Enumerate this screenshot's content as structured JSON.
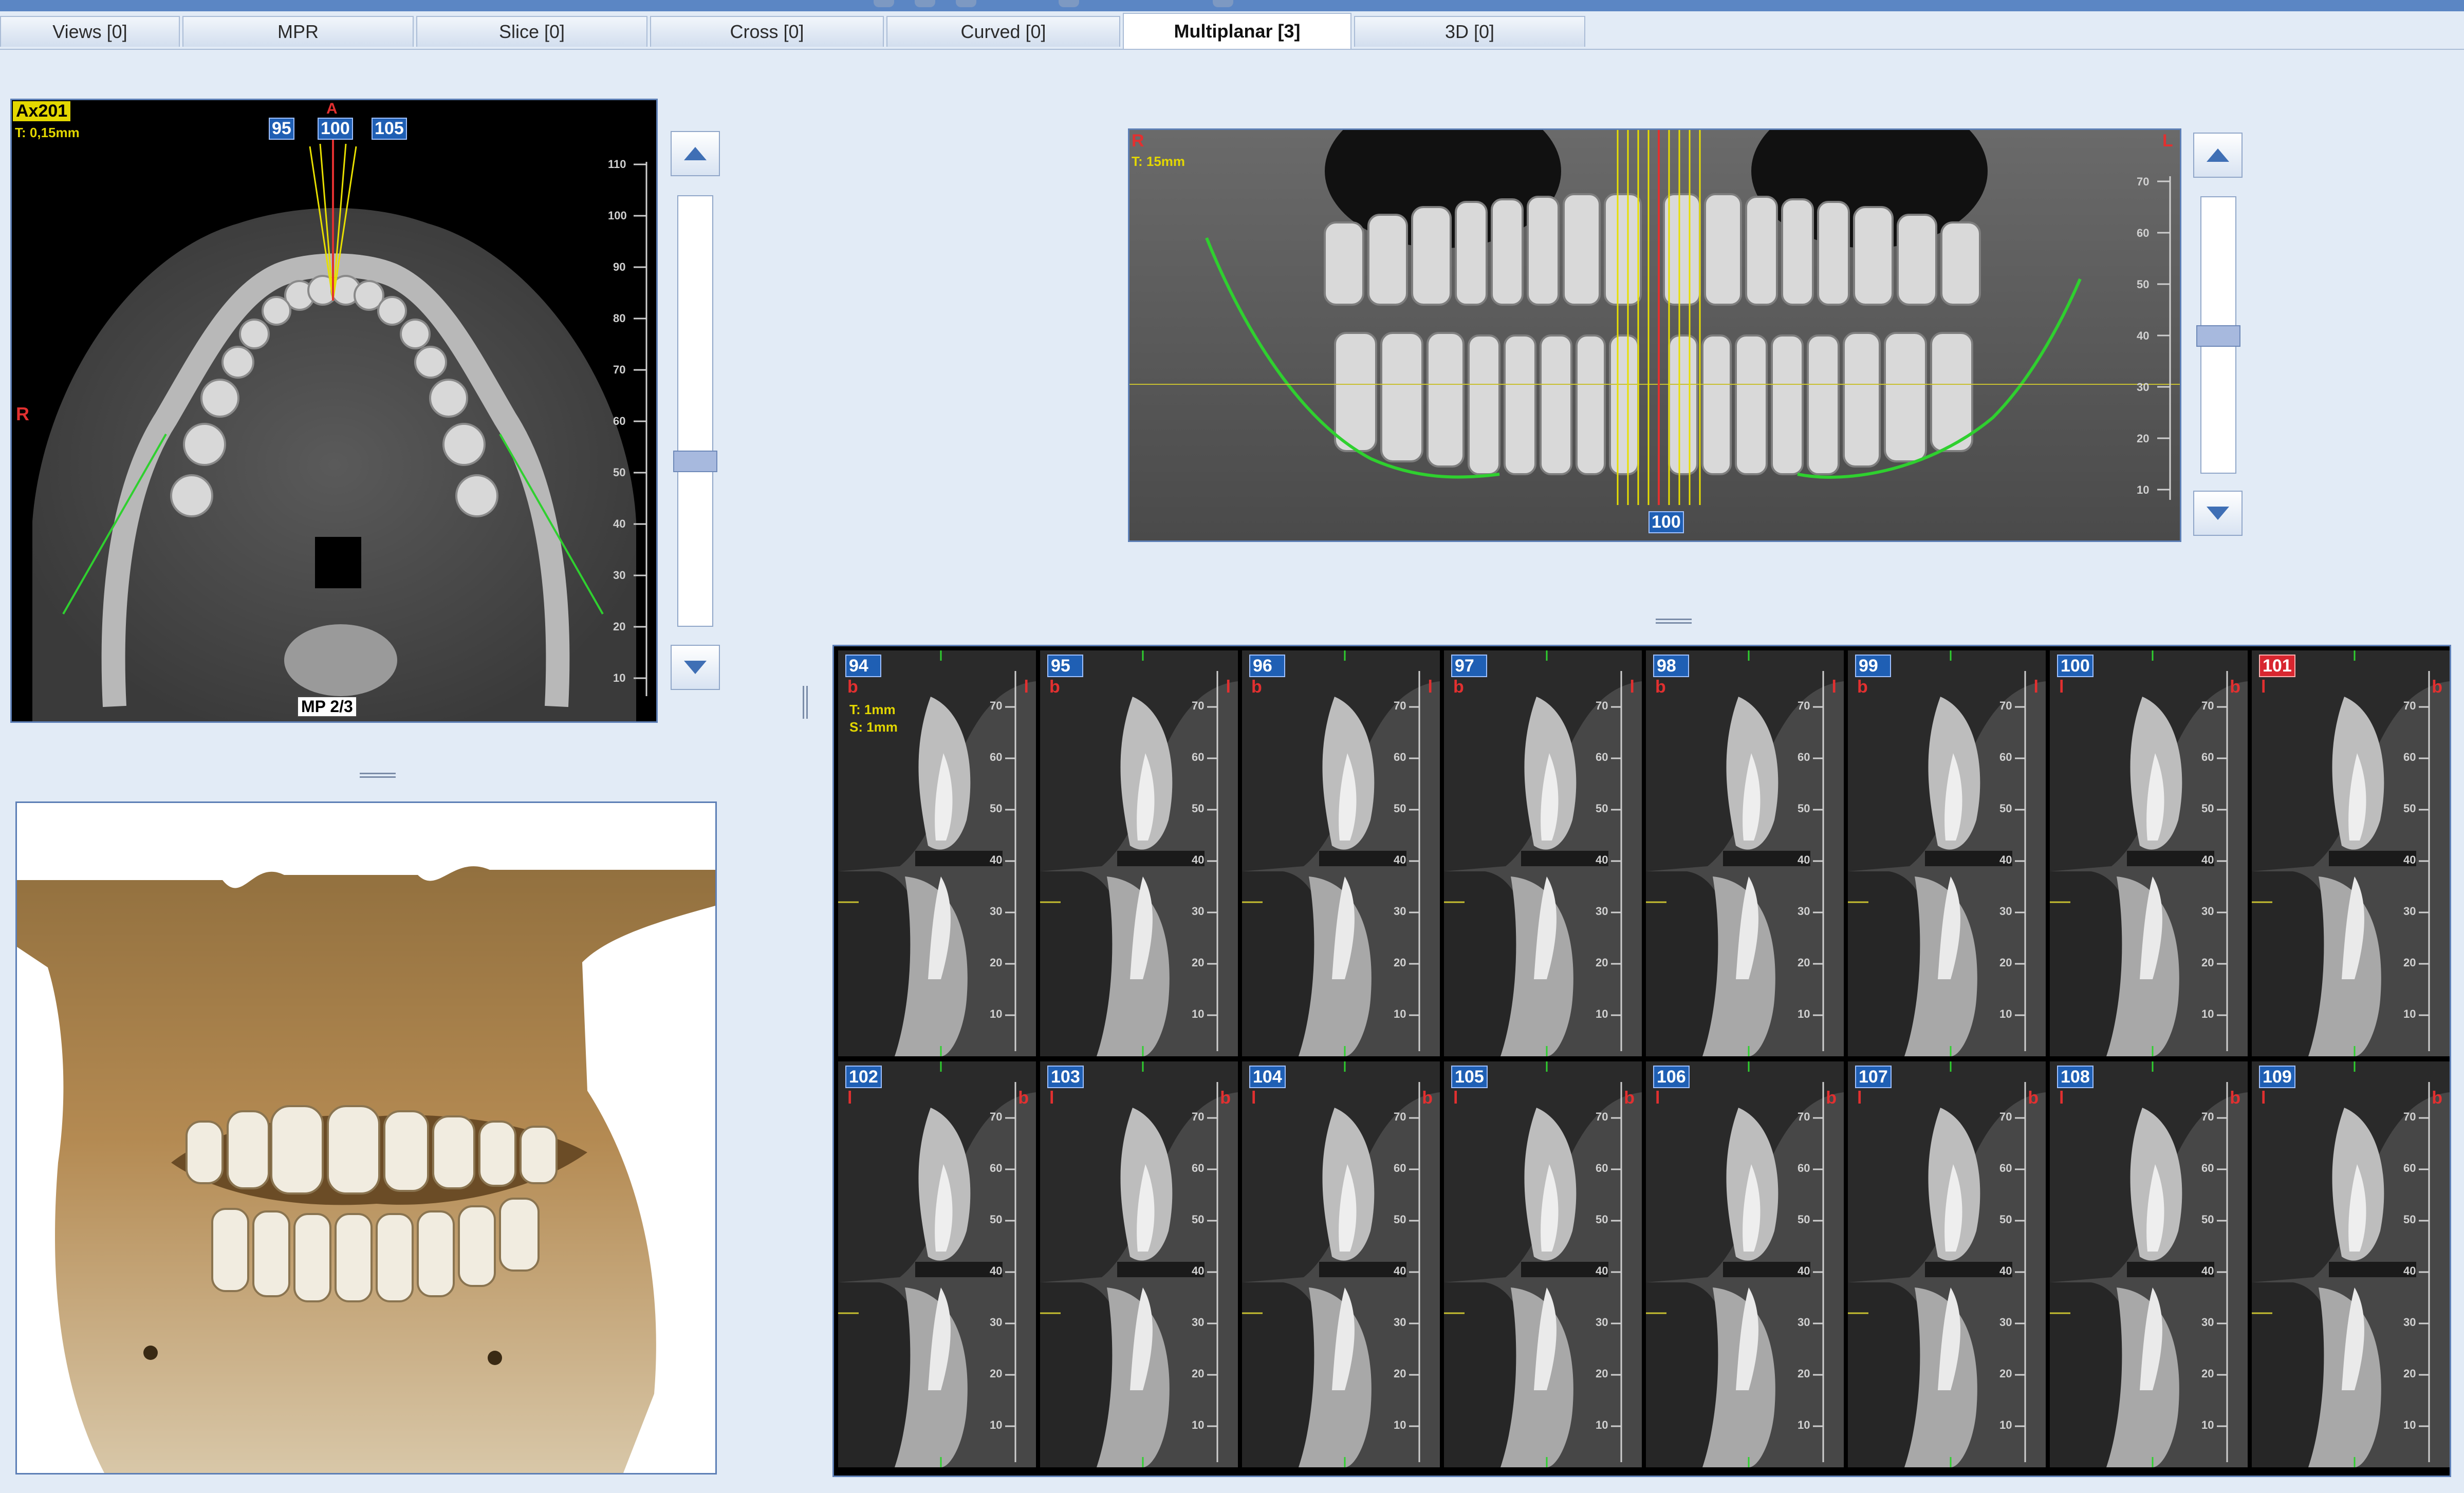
{
  "tabs": [
    {
      "label": "Views [0]",
      "active": false
    },
    {
      "label": "MPR",
      "active": false
    },
    {
      "label": "Slice [0]",
      "active": false
    },
    {
      "label": "Cross [0]",
      "active": false
    },
    {
      "label": "Curved [0]",
      "active": false
    },
    {
      "label": "Multiplanar [3]",
      "active": true
    },
    {
      "label": "3D [0]",
      "active": false
    }
  ],
  "axial": {
    "name": "Ax201",
    "thickness": "T: 0,15mm",
    "right_marker": "R",
    "anterior_marker": "A",
    "slices": [
      "95",
      "100",
      "105"
    ],
    "footer": "MP 2/3",
    "ruler": [
      "110",
      "100",
      "90",
      "80",
      "70",
      "60",
      "50",
      "40",
      "30",
      "20",
      "10"
    ]
  },
  "panoramic": {
    "right_marker": "R",
    "left_marker": "L",
    "thickness": "T: 15mm",
    "slice": "100",
    "ruler": [
      "70",
      "60",
      "50",
      "40",
      "30",
      "20",
      "10"
    ]
  },
  "cross_info": {
    "thickness": "T: 1mm",
    "spacing": "S: 1mm"
  },
  "cross_ruler": [
    "70",
    "60",
    "50",
    "40",
    "30",
    "20",
    "10"
  ],
  "cross_sections": [
    {
      "label": "94",
      "left": "b",
      "right": "l",
      "selected": false
    },
    {
      "label": "95",
      "left": "b",
      "right": "l",
      "selected": false
    },
    {
      "label": "96",
      "left": "b",
      "right": "l",
      "selected": false
    },
    {
      "label": "97",
      "left": "b",
      "right": "l",
      "selected": false
    },
    {
      "label": "98",
      "left": "b",
      "right": "l",
      "selected": false
    },
    {
      "label": "99",
      "left": "b",
      "right": "l",
      "selected": false
    },
    {
      "label": "100",
      "left": "l",
      "right": "b",
      "selected": false
    },
    {
      "label": "101",
      "left": "l",
      "right": "b",
      "selected": true
    },
    {
      "label": "102",
      "left": "l",
      "right": "b",
      "selected": false
    },
    {
      "label": "103",
      "left": "l",
      "right": "b",
      "selected": false
    },
    {
      "label": "104",
      "left": "l",
      "right": "b",
      "selected": false
    },
    {
      "label": "105",
      "left": "l",
      "right": "b",
      "selected": false
    },
    {
      "label": "106",
      "left": "l",
      "right": "b",
      "selected": false
    },
    {
      "label": "107",
      "left": "l",
      "right": "b",
      "selected": false
    },
    {
      "label": "108",
      "left": "l",
      "right": "b",
      "selected": false
    },
    {
      "label": "109",
      "left": "l",
      "right": "b",
      "selected": false
    }
  ],
  "scroll": {
    "axial_position": 0.62,
    "panoramic_position": 0.5
  },
  "colors": {
    "accent": "#1f5fb4",
    "selected": "#d8262f",
    "nerve": "#2fd02f",
    "guide": "#e8e000",
    "frame": "#5d7fb6"
  },
  "icons": {
    "scroll_up": "arrow-up-icon",
    "scroll_down": "arrow-down-icon"
  }
}
